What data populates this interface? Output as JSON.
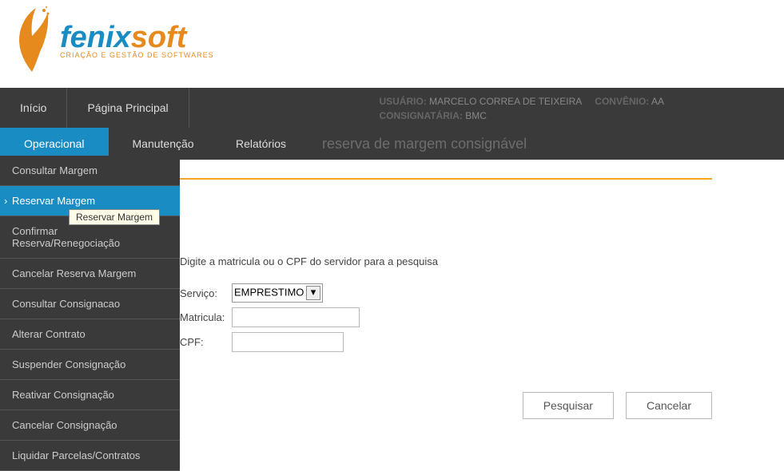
{
  "logo": {
    "name_part1": "fenix",
    "name_part2": "soft",
    "tagline": "CRIAÇÃO E GESTÃO DE SOFTWARES"
  },
  "top_nav": {
    "inicio": "Início",
    "pagina_principal": "Página Principal"
  },
  "user_info": {
    "usuario_label": "USUÁRIO:",
    "usuario_value": "MARCELO CORREA DE TEIXEIRA",
    "convenio_label": "CONVÊNIO:",
    "convenio_value": "AA",
    "consignataria_label": "CONSIGNATÁRIA:",
    "consignataria_value": "BMC"
  },
  "sub_nav": {
    "operacional": "Operacional",
    "manutencao": "Manutenção",
    "relatorios": "Relatórios"
  },
  "page_title": "reserva de margem consignável",
  "sidebar": {
    "items": [
      "Consultar Margem",
      "Reservar Margem",
      "Confirmar Reserva/Renegociação",
      "Cancelar Reserva Margem",
      "Consultar Consignacao",
      "Alterar Contrato",
      "Suspender Consignação",
      "Reativar Consignação",
      "Cancelar Consignação",
      "Liquidar Parcelas/Contratos"
    ],
    "active_index": 1
  },
  "tooltip": "Reservar Margem",
  "form": {
    "instruction": "Digite a matricula ou o CPF do servidor para a pesquisa",
    "servico_label": "Serviço:",
    "servico_value": "EMPRESTIMO",
    "matricula_label": "Matricula:",
    "matricula_value": "",
    "cpf_label": "CPF:",
    "cpf_value": ""
  },
  "buttons": {
    "pesquisar": "Pesquisar",
    "cancelar": "Cancelar"
  }
}
